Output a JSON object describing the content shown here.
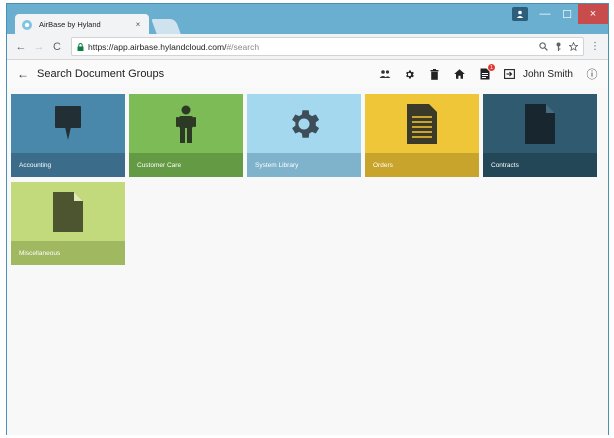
{
  "browser": {
    "tab_title": "AirBase by Hyland",
    "tab_close": "×",
    "url_main": "https://app.airbase.hylandcloud.com/",
    "url_rest": "#/search",
    "nav": {
      "back": "←",
      "forward": "→",
      "reload": "C"
    },
    "omnibox_icons": [
      "search-icon",
      "key-icon",
      "star-icon"
    ],
    "menu": "⋮",
    "window_controls": {
      "minimize": "—",
      "maximize": "☐",
      "close": "×"
    }
  },
  "app": {
    "back": "←",
    "title": "Search Document Groups",
    "actions": [
      "people-icon",
      "gear-icon",
      "trash-icon",
      "home-icon",
      "document-badge-icon",
      "logout-icon"
    ],
    "badge_count": "1",
    "user_name": "John Smith",
    "info": "ⓘ"
  },
  "tiles": [
    {
      "label": "Accounting",
      "icon": "speech-bubble-icon",
      "color": "#4a88ab",
      "caption_color": "#3b6d8b"
    },
    {
      "label": "Customer Care",
      "icon": "person-icon",
      "color": "#7dbb56",
      "caption_color": "#659a45"
    },
    {
      "label": "System Library",
      "icon": "gear-icon",
      "color": "#a4d8ef",
      "caption_color": "#7fb2cb"
    },
    {
      "label": "Orders",
      "icon": "invoice-icon",
      "color": "#efc637",
      "caption_color": "#c9a42c"
    },
    {
      "label": "Contracts",
      "icon": "document-icon",
      "color": "#2f5a70",
      "caption_color": "#234757"
    },
    {
      "label": "Miscellaneous",
      "icon": "document-icon",
      "color": "#c2d97c",
      "caption_color": "#a0b860"
    }
  ]
}
